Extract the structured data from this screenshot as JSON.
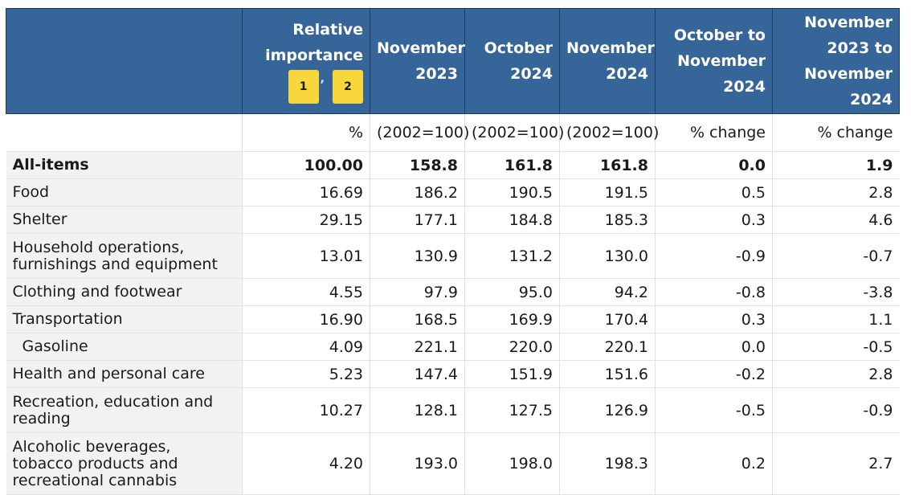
{
  "columns": [
    {
      "lines": [
        "Relative",
        "importance"
      ],
      "footnotes": [
        "1",
        "2"
      ]
    },
    {
      "lines": [
        "November",
        "2023"
      ]
    },
    {
      "lines": [
        "October",
        "2024"
      ]
    },
    {
      "lines": [
        "November",
        "2024"
      ]
    },
    {
      "lines": [
        "October to",
        "November",
        "2024"
      ]
    },
    {
      "lines": [
        "November",
        "2023 to",
        "November",
        "2024"
      ]
    }
  ],
  "units": [
    "%",
    "(2002=100)",
    "(2002=100)",
    "(2002=100)",
    "% change",
    "% change"
  ],
  "rows": [
    {
      "label": "All-items",
      "values": [
        "100.00",
        "158.8",
        "161.8",
        "161.8",
        "0.0",
        "1.9"
      ]
    },
    {
      "label": "Food",
      "values": [
        "16.69",
        "186.2",
        "190.5",
        "191.5",
        "0.5",
        "2.8"
      ]
    },
    {
      "label": "Shelter",
      "values": [
        "29.15",
        "177.1",
        "184.8",
        "185.3",
        "0.3",
        "4.6"
      ]
    },
    {
      "label": "Household operations, furnishings and equipment",
      "values": [
        "13.01",
        "130.9",
        "131.2",
        "130.0",
        "-0.9",
        "-0.7"
      ]
    },
    {
      "label": "Clothing and footwear",
      "values": [
        "4.55",
        "97.9",
        "95.0",
        "94.2",
        "-0.8",
        "-3.8"
      ]
    },
    {
      "label": "Transportation",
      "values": [
        "16.90",
        "168.5",
        "169.9",
        "170.4",
        "0.3",
        "1.1"
      ]
    },
    {
      "label": "Gasoline",
      "values": [
        "4.09",
        "221.1",
        "220.0",
        "220.1",
        "0.0",
        "-0.5"
      ]
    },
    {
      "label": "Health and personal care",
      "values": [
        "5.23",
        "147.4",
        "151.9",
        "151.6",
        "-0.2",
        "2.8"
      ]
    },
    {
      "label": "Recreation, education and reading",
      "values": [
        "10.27",
        "128.1",
        "127.5",
        "126.9",
        "-0.5",
        "-0.9"
      ]
    },
    {
      "label": "Alcoholic beverages, tobacco products and recreational cannabis",
      "values": [
        "4.20",
        "193.0",
        "198.0",
        "198.3",
        "0.2",
        "2.7"
      ]
    }
  ],
  "colors": {
    "header_bg": "#36659a",
    "footnote_bg": "#f8d63c",
    "stub_bg": "#f2f2f2"
  }
}
